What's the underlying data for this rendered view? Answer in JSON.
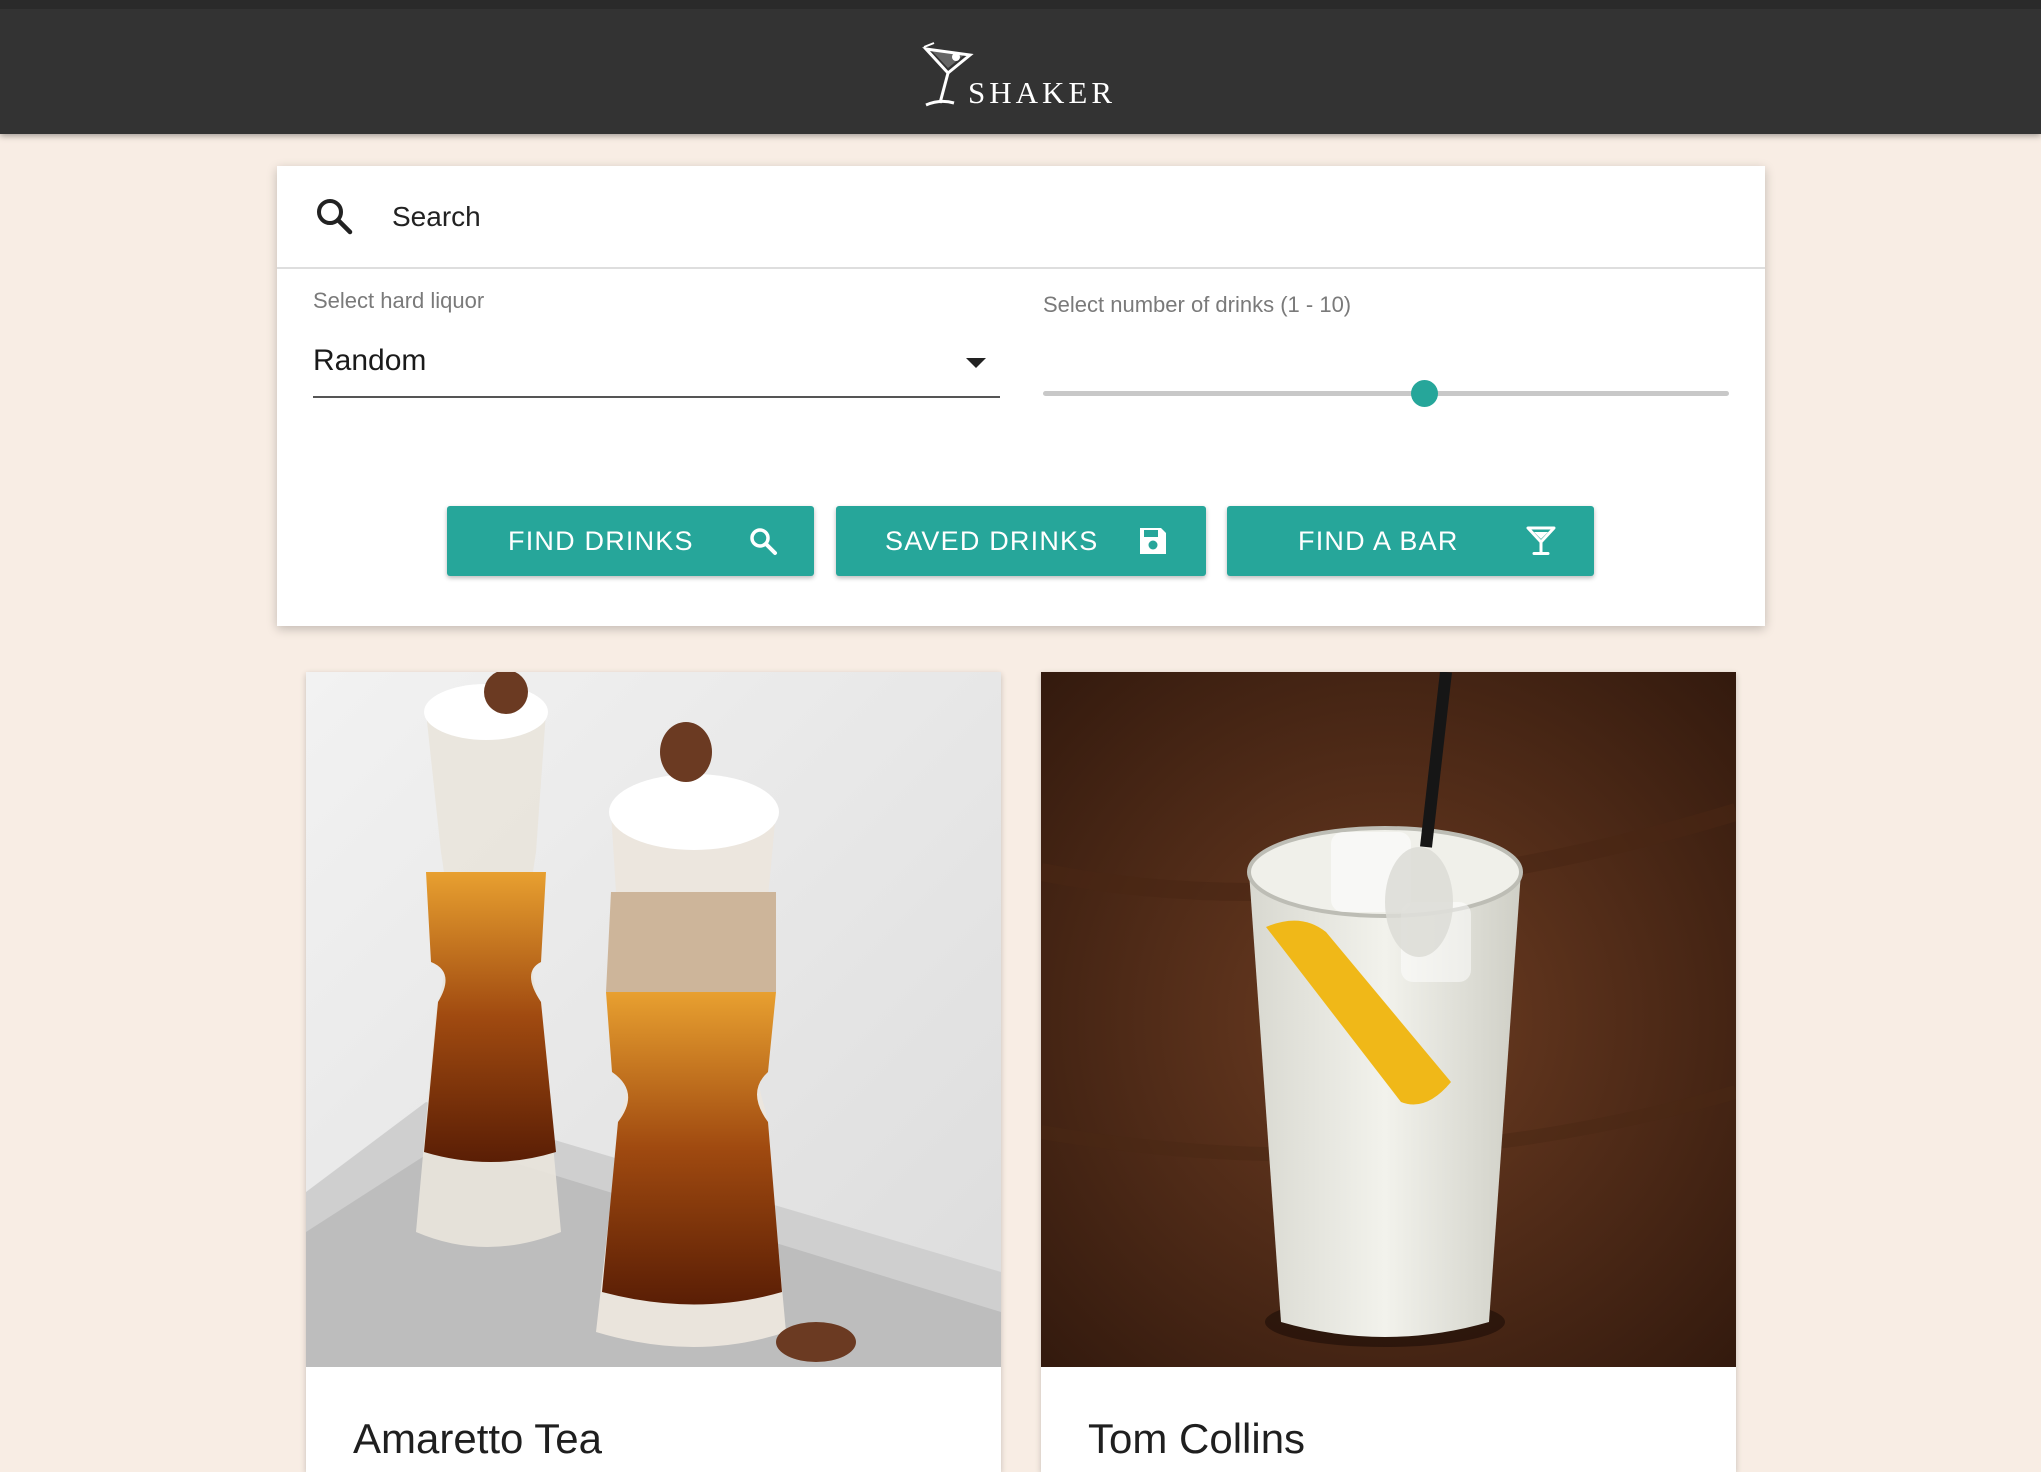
{
  "header": {
    "brand": "SHAKER"
  },
  "search": {
    "placeholder": "Search",
    "icon": "search-icon"
  },
  "filters": {
    "liquor_label": "Select hard liquor",
    "liquor_value": "Random",
    "drinks_label": "Select number of drinks (1 - 10)",
    "drinks_min": 1,
    "drinks_max": 10,
    "drinks_value": 6
  },
  "actions": {
    "find_drinks": {
      "label": "FIND DRINKS",
      "icon": "search-icon"
    },
    "saved_drinks": {
      "label": "SAVED DRINKS",
      "icon": "save-icon"
    },
    "find_bar": {
      "label": "FIND A BAR",
      "icon": "cocktail-glass-icon"
    }
  },
  "drinks": [
    {
      "name": "Amaretto Tea"
    },
    {
      "name": "Tom Collins"
    }
  ],
  "colors": {
    "accent": "#26a69a",
    "header_bg": "#333333",
    "page_bg": "#f8ede4"
  }
}
